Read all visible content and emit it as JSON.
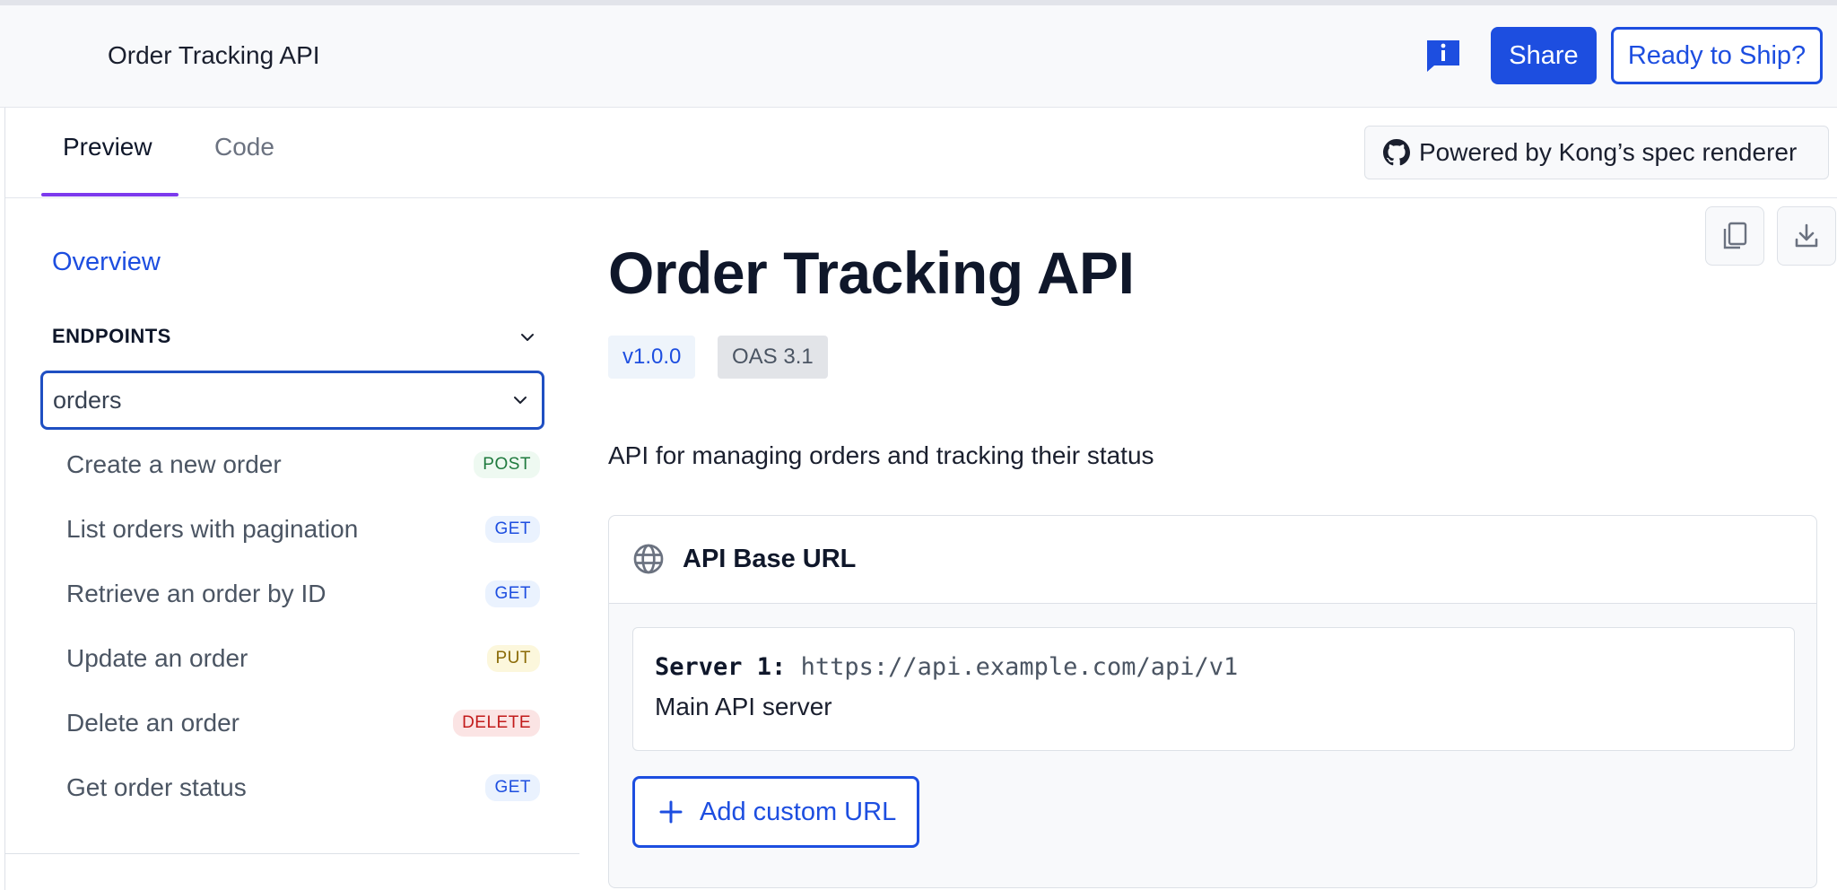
{
  "header": {
    "app_title": "Order Tracking API",
    "info_icon": "info-icon",
    "share_label": "Share",
    "ship_label": "Ready to Ship?"
  },
  "tabs": [
    {
      "label": "Preview",
      "active": true
    },
    {
      "label": "Code",
      "active": false
    }
  ],
  "kong": {
    "icon": "github-icon",
    "label": "Powered by Kong’s spec renderer"
  },
  "sidebar": {
    "overview_label": "Overview",
    "endpoints_label": "ENDPOINTS",
    "group_label": "orders",
    "items": [
      {
        "label": "Create a new order",
        "method": "POST"
      },
      {
        "label": "List orders with pagination",
        "method": "GET"
      },
      {
        "label": "Retrieve an order by ID",
        "method": "GET"
      },
      {
        "label": "Update an order",
        "method": "PUT"
      },
      {
        "label": "Delete an order",
        "method": "DELETE"
      },
      {
        "label": "Get order status",
        "method": "GET"
      }
    ]
  },
  "main": {
    "title": "Order Tracking API",
    "version": "v1.0.0",
    "oas": "OAS 3.1",
    "description": "API for managing orders and tracking their status",
    "server_section": {
      "title": "API Base URL",
      "icon": "globe-icon",
      "server_label": "Server 1:",
      "server_url": "https://api.example.com/api/v1",
      "server_description": "Main API server",
      "add_label": "Add custom URL"
    }
  },
  "colors": {
    "accent": "#1d4ee0",
    "tab_indicator": "#7c3aed",
    "post": "#1f7a3e",
    "get": "#1d4ee0",
    "put": "#8a6a06",
    "delete": "#c21b1b"
  }
}
